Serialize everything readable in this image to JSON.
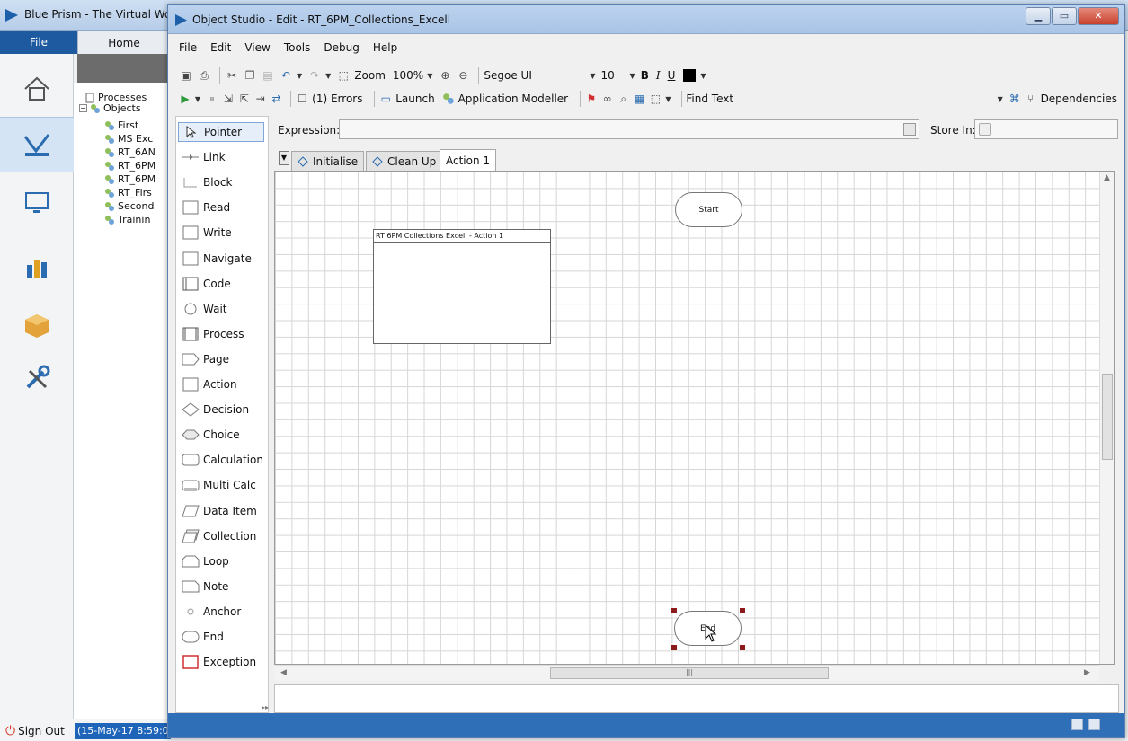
{
  "background_app": {
    "title": "Blue Prism - The Virtual Wor",
    "ribbon": {
      "file_tab": "File",
      "home_tab": "Home"
    },
    "nav_icons": [
      "home-icon",
      "studio-icon",
      "control-room-icon",
      "analytics-icon",
      "releases-icon",
      "system-icon"
    ],
    "tree": {
      "processes": "Processes",
      "objects": "Objects",
      "object_items": [
        "First",
        "MS Exc",
        "RT_6AN",
        "RT_6PM",
        "RT_6PM",
        "RT_Firs",
        "Second",
        "Trainin"
      ]
    },
    "sign_out": "Sign Out",
    "status_date": "(15-May-17 8:59:0"
  },
  "object_studio": {
    "title": "Object Studio - Edit - RT_6PM_Collections_Excell",
    "menu": [
      "File",
      "Edit",
      "View",
      "Tools",
      "Debug",
      "Help"
    ],
    "toolbar1": {
      "zoom_label": "Zoom",
      "zoom_value": "100%",
      "font_name": "Segoe UI",
      "font_size": "10",
      "bold": "B",
      "italic": "I",
      "underline": "U"
    },
    "toolbar2": {
      "errors": "(1) Errors",
      "launch": "Launch",
      "app_modeller": "Application Modeller",
      "find_text": "Find Text",
      "dependencies": "Dependencies"
    },
    "palette": [
      {
        "label": "Pointer",
        "icon": "pointer-icon"
      },
      {
        "label": "Link",
        "icon": "link-icon"
      },
      {
        "label": "Block",
        "icon": "block-icon"
      },
      {
        "label": "Read",
        "icon": "read-icon"
      },
      {
        "label": "Write",
        "icon": "write-icon"
      },
      {
        "label": "Navigate",
        "icon": "navigate-icon"
      },
      {
        "label": "Code",
        "icon": "code-icon"
      },
      {
        "label": "Wait",
        "icon": "wait-icon"
      },
      {
        "label": "Process",
        "icon": "process-icon"
      },
      {
        "label": "Page",
        "icon": "page-icon"
      },
      {
        "label": "Action",
        "icon": "action-icon"
      },
      {
        "label": "Decision",
        "icon": "decision-icon"
      },
      {
        "label": "Choice",
        "icon": "choice-icon"
      },
      {
        "label": "Calculation",
        "icon": "calculation-icon"
      },
      {
        "label": "Multi Calc",
        "icon": "multi-calc-icon"
      },
      {
        "label": "Data Item",
        "icon": "data-item-icon"
      },
      {
        "label": "Collection",
        "icon": "collection-icon"
      },
      {
        "label": "Loop",
        "icon": "loop-icon"
      },
      {
        "label": "Note",
        "icon": "note-icon"
      },
      {
        "label": "Anchor",
        "icon": "anchor-icon"
      },
      {
        "label": "End",
        "icon": "end-icon"
      },
      {
        "label": "Exception",
        "icon": "exception-icon"
      }
    ],
    "expression_label": "Expression:",
    "store_in_label": "Store In:",
    "tabs": [
      "Initialise",
      "Clean Up",
      "Action 1"
    ],
    "canvas": {
      "page_info_title": "RT 6PM Collections Excell - Action 1",
      "start_label": "Start",
      "end_label": "End"
    },
    "colors": {
      "statusbar": "#2f6fb7",
      "selection_handle": "#8b1a1a",
      "exception_border": "#d03030"
    }
  }
}
